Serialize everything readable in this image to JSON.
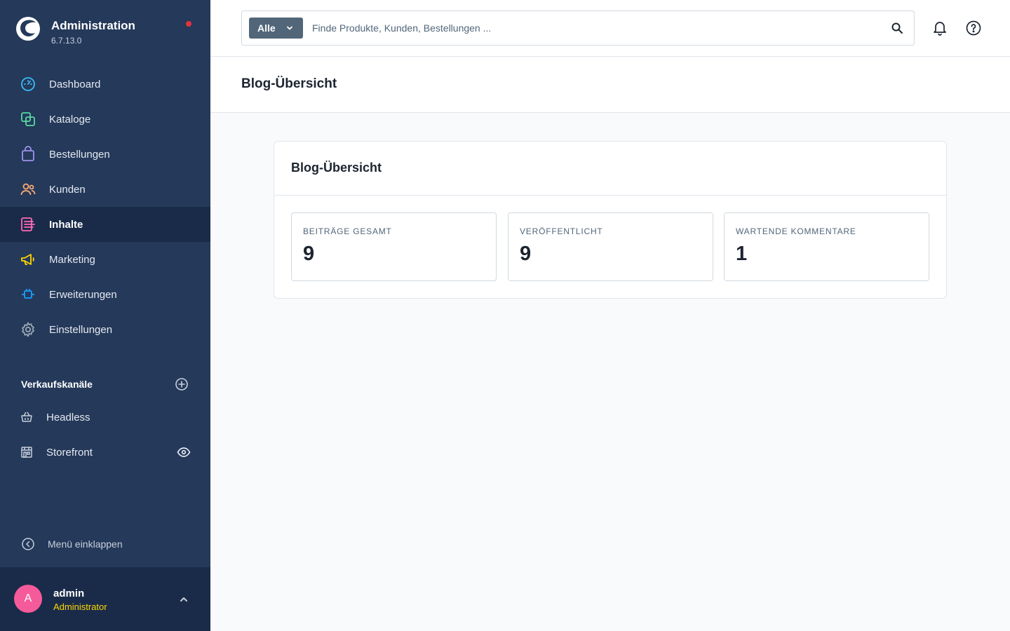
{
  "brand": {
    "title": "Administration",
    "version": "6.7.13.0"
  },
  "nav": {
    "items": [
      {
        "label": "Dashboard",
        "icon": "dashboard-gauge-icon",
        "color": "#38bdf8"
      },
      {
        "label": "Kataloge",
        "icon": "catalog-icon",
        "color": "#57d9a3"
      },
      {
        "label": "Bestellungen",
        "icon": "shopping-bag-icon",
        "color": "#a092f0"
      },
      {
        "label": "Kunden",
        "icon": "users-icon",
        "color": "#ffab71"
      },
      {
        "label": "Inhalte",
        "icon": "content-icon",
        "color": "#ff68b4",
        "active": true
      },
      {
        "label": "Marketing",
        "icon": "megaphone-icon",
        "color": "#ffd700"
      },
      {
        "label": "Erweiterungen",
        "icon": "plugin-icon",
        "color": "#189eff"
      },
      {
        "label": "Einstellungen",
        "icon": "gear-icon",
        "color": "#9aa8b5"
      }
    ]
  },
  "sales_channels": {
    "title": "Verkaufskanäle",
    "items": [
      {
        "label": "Headless",
        "icon": "basket-icon"
      },
      {
        "label": "Storefront",
        "icon": "storefront-icon"
      }
    ]
  },
  "collapse_label": "Menü einklappen",
  "user": {
    "initial": "A",
    "name": "admin",
    "role": "Administrator"
  },
  "search": {
    "scope": "Alle",
    "placeholder": "Finde Produkte, Kunden, Bestellungen ..."
  },
  "page": {
    "title": "Blog-Übersicht"
  },
  "card": {
    "title": "Blog-Übersicht",
    "stats": [
      {
        "label": "BEITRÄGE GESAMT",
        "value": "9"
      },
      {
        "label": "VERÖFFENTLICHT",
        "value": "9"
      },
      {
        "label": "WARTENDE KOMMENTARE",
        "value": "1"
      }
    ]
  },
  "colors": {
    "sidebar": "#25395a",
    "sidebar_active": "#1a2b4a",
    "accent_pink": "#f55b9a",
    "role_yellow": "#ffd700"
  }
}
